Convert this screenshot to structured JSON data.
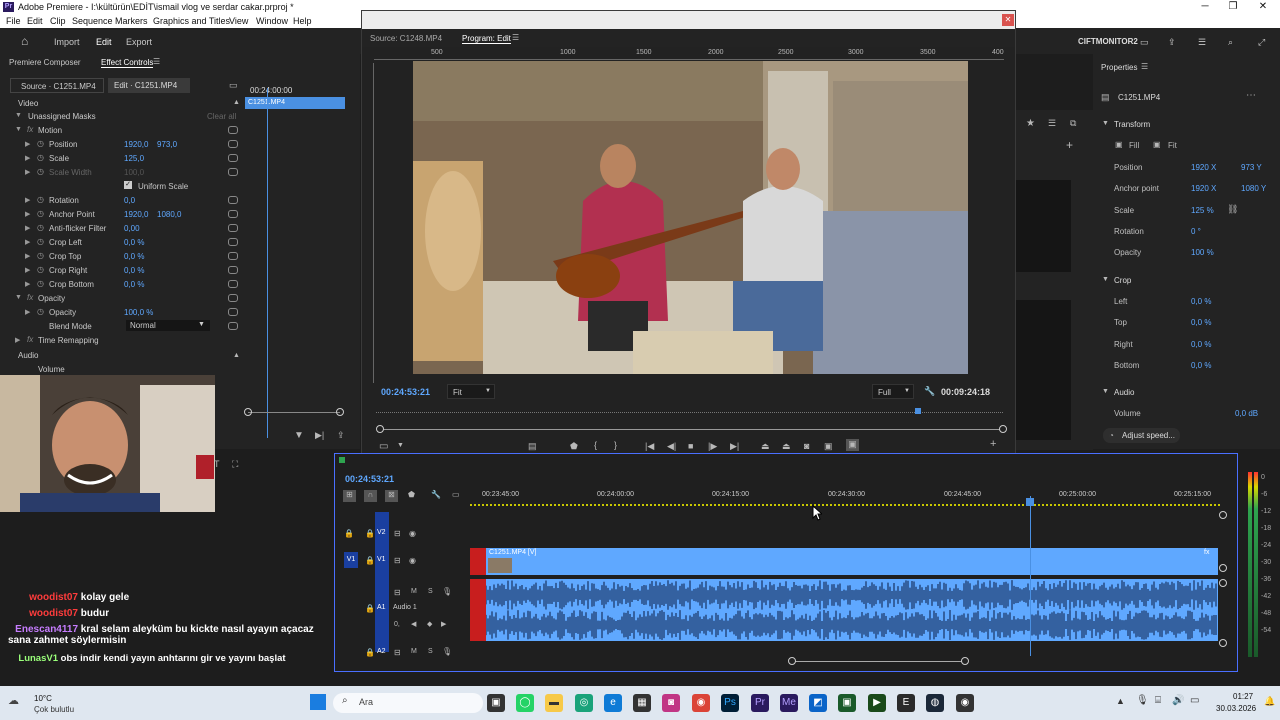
{
  "window": {
    "title": "Adobe Premiere - I:\\kültürün\\EDİT\\ismail vlog ve serdar cakar.prproj *",
    "app_logo": "Pr"
  },
  "menu": [
    "File",
    "Edit",
    "Clip",
    "Sequence",
    "Markers",
    "Graphics and Titles",
    "View",
    "Window",
    "Help"
  ],
  "workspace": {
    "tabs": [
      "Import",
      "Edit",
      "Export"
    ],
    "active": "Edit",
    "right_label": "CIFTMONITOR2"
  },
  "left_panel": {
    "tabs": [
      "Premiere Composer",
      "Effect Controls"
    ],
    "source_tab": "Source · C1251.MP4",
    "edit_tab": "Edit · C1251.MP4",
    "timecode": "00:24:00:00",
    "clip_name": "C1251.MP4",
    "sections": {
      "video": "Video",
      "audio": "Audio",
      "unassigned_masks": "Unassigned Masks",
      "clear_all": "Clear all"
    },
    "params": [
      {
        "name": "Motion",
        "level": 0,
        "fx": true
      },
      {
        "name": "Position",
        "level": 1,
        "v1": "1920,0",
        "v2": "973,0"
      },
      {
        "name": "Scale",
        "level": 1,
        "v1": "125,0"
      },
      {
        "name": "Scale Width",
        "level": 1,
        "v1": "100,0",
        "dim": true
      },
      {
        "name": "Uniform Scale",
        "level": 2,
        "checkbox": true
      },
      {
        "name": "Rotation",
        "level": 1,
        "v1": "0,0"
      },
      {
        "name": "Anchor Point",
        "level": 1,
        "v1": "1920,0",
        "v2": "1080,0"
      },
      {
        "name": "Anti-flicker Filter",
        "level": 1,
        "v1": "0,00"
      },
      {
        "name": "Crop Left",
        "level": 1,
        "v1": "0,0 %"
      },
      {
        "name": "Crop Top",
        "level": 1,
        "v1": "0,0 %"
      },
      {
        "name": "Crop Right",
        "level": 1,
        "v1": "0,0 %"
      },
      {
        "name": "Crop Bottom",
        "level": 1,
        "v1": "0,0 %"
      },
      {
        "name": "Opacity",
        "level": 0,
        "fx": true
      },
      {
        "name": "Opacity",
        "level": 1,
        "v1": "100,0 %"
      },
      {
        "name": "Blend Mode",
        "level": 1,
        "select": "Normal"
      },
      {
        "name": "Time Remapping",
        "level": 0,
        "fx": true
      }
    ],
    "volume_label": "Volume"
  },
  "monitor": {
    "source_tab": "Source: C1248.MP4",
    "program_tab": "Program: Edit",
    "ruler": [
      "500",
      "1000",
      "1500",
      "2000",
      "2500",
      "3000",
      "3500",
      "400"
    ],
    "current_timecode": "00:24:53:21",
    "fit_select": "Fit",
    "quality_select": "Full",
    "duration": "00:09:24:18"
  },
  "properties": {
    "title": "Properties",
    "clip": "C1251.MP4",
    "transform_label": "Transform",
    "fill_label": "Fill",
    "fit_label": "Fit",
    "position": {
      "label": "Position",
      "x": "1920 X",
      "y": "973 Y"
    },
    "anchor": {
      "label": "Anchor point",
      "x": "1920 X",
      "y": "1080 Y"
    },
    "scale": {
      "label": "Scale",
      "v": "125 %"
    },
    "rotation": {
      "label": "Rotation",
      "v": "0 °"
    },
    "opacity": {
      "label": "Opacity",
      "v": "100 %"
    },
    "crop_label": "Crop",
    "crop": [
      {
        "label": "Left",
        "v": "0,0 %"
      },
      {
        "label": "Top",
        "v": "0,0 %"
      },
      {
        "label": "Right",
        "v": "0,0 %"
      },
      {
        "label": "Bottom",
        "v": "0,0 %"
      }
    ],
    "audio_label": "Audio",
    "volume": {
      "label": "Volume",
      "v": "0,0 dB"
    },
    "adjust_speed": "Adjust speed..."
  },
  "timeline": {
    "timecode": "00:24:53:21",
    "ruler": [
      "00:23:45:00",
      "00:24:00:00",
      "00:24:15:00",
      "00:24:30:00",
      "00:24:45:00",
      "00:25:00:00",
      "00:25:15:00"
    ],
    "tracks": {
      "v2": "V2",
      "v1": "V1",
      "a1": "A1",
      "a1_name": "Audio 1",
      "a2": "A2",
      "src_v1": "V1",
      "src_a1": "A1"
    },
    "clip_video": "C1251.MP4 [V]",
    "meter_ticks": [
      "0",
      "-6",
      "-12",
      "-18",
      "-24",
      "-30",
      "-36",
      "-42",
      "-48",
      "-54"
    ]
  },
  "chat": [
    {
      "user": "woodist07",
      "text": "kolay gele",
      "color": "#ff3c3c"
    },
    {
      "user": "woodist07",
      "text": "budur",
      "color": "#ff3c3c"
    },
    {
      "user": "Enescan4117",
      "text": "kral selam aleyküm bu kickte nasıl ayayın açacaz sana zahmet söylermisin",
      "color": "#c77dff"
    },
    {
      "user": "LunasV1",
      "text": "obs indir kendi yayın anhtarını gir ve yayını başlat",
      "color": "#9aff7a"
    }
  ],
  "taskbar": {
    "weather_temp": "10°C",
    "weather_desc": "Çok bulutlu",
    "search": "Ara",
    "time": "01:27",
    "date": "30.03.2026"
  }
}
